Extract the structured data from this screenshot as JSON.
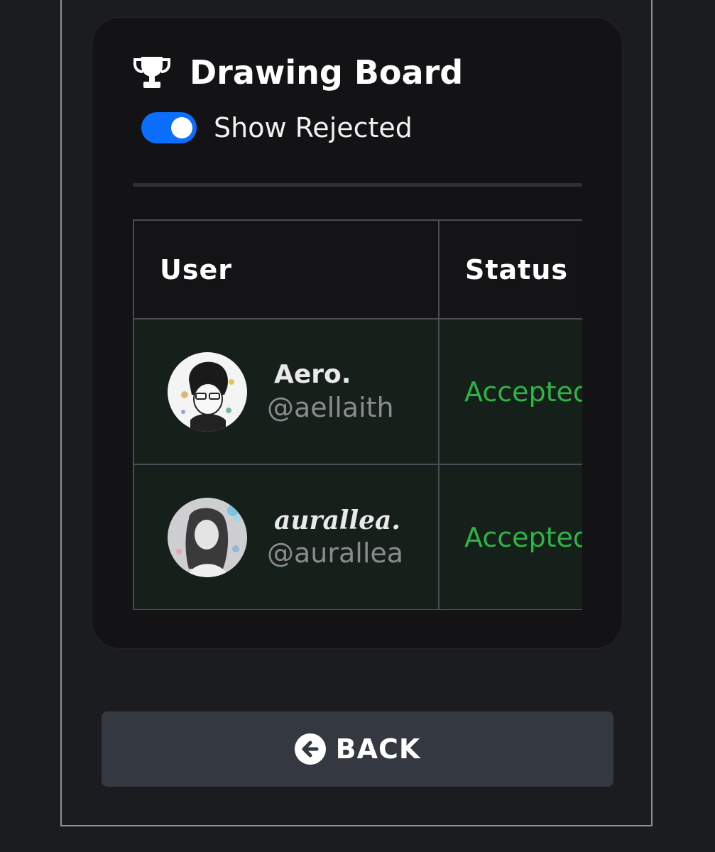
{
  "board": {
    "title": "Drawing Board",
    "title_icon": "trophy-icon",
    "toggle": {
      "label": "Show Rejected",
      "on": true,
      "color": "#0b6efd"
    }
  },
  "table": {
    "headers": [
      "User",
      "Status"
    ],
    "rows": [
      {
        "display_name": "Aero.",
        "handle": "@aellaith",
        "status": "Accepted"
      },
      {
        "display_name": "aurallea.",
        "handle": "@aurallea",
        "status": "Accepted"
      }
    ],
    "status_color": "#2fb344"
  },
  "footer": {
    "back_label": "BACK",
    "back_icon": "arrow-left-circle-icon"
  }
}
